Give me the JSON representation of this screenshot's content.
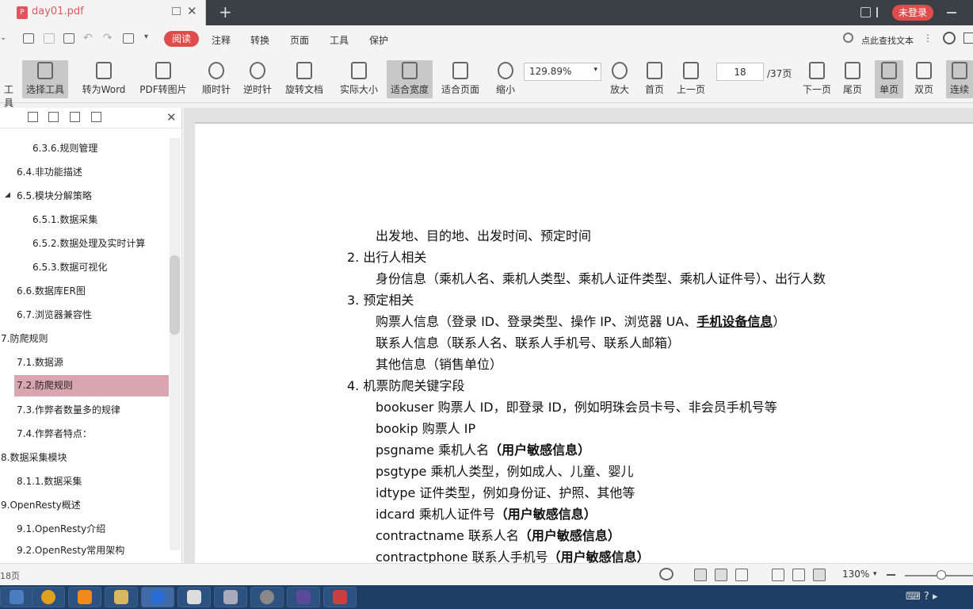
{
  "titlebar": {
    "tab_title": "day01.pdf",
    "new_tab": "+",
    "login_label": "未登录"
  },
  "menu": {
    "items": [
      "阅读",
      "注释",
      "转换",
      "页面",
      "工具",
      "保护"
    ],
    "search_label": "点此查找文本"
  },
  "toolbar": {
    "tools": [
      "工具",
      "选择工具",
      "转为Word",
      "PDF转图片",
      "顺时针",
      "逆时针",
      "旋转文档",
      "实际大小",
      "适合宽度",
      "适合页面",
      "缩小",
      "放大",
      "首页",
      "上一页",
      "下一页",
      "尾页",
      "单页",
      "双页",
      "连续"
    ],
    "zoom_value": "129.89%",
    "page_current": "18",
    "page_total": "/37页"
  },
  "sidebar": {
    "toc": [
      {
        "label": "6.3.6.规则管理",
        "level": 3
      },
      {
        "label": "6.4.非功能描述",
        "level": 2
      },
      {
        "label": "6.5.模块分解策略",
        "level": 2
      },
      {
        "label": "6.5.1.数据采集",
        "level": 3
      },
      {
        "label": "6.5.2.数据处理及实时计算",
        "level": 3
      },
      {
        "label": "6.5.3.数据可视化",
        "level": 3
      },
      {
        "label": "6.6.数据库ER图",
        "level": 2
      },
      {
        "label": "6.7.浏览器兼容性",
        "level": 2
      },
      {
        "label": "7.防爬规则",
        "level": 1
      },
      {
        "label": "7.1.数据源",
        "level": 2
      },
      {
        "label": "7.2.防爬规则",
        "level": 2,
        "selected": true
      },
      {
        "label": "7.3.作弊者数量多的规律",
        "level": 2
      },
      {
        "label": "7.4.作弊者特点：",
        "level": 2
      },
      {
        "label": "8.数据采集模块",
        "level": 1
      },
      {
        "label": "8.1.1.数据采集",
        "level": 2
      },
      {
        "label": "9.OpenResty概述",
        "level": 1
      },
      {
        "label": "9.1.OpenResty介绍",
        "level": 2
      },
      {
        "label": "9.2.OpenResty常用架构",
        "level": 2
      }
    ]
  },
  "document": {
    "lines": [
      {
        "text": "出发地、目的地、出发时间、预定时间"
      },
      {
        "num": "2.",
        "text": "出行人相关"
      },
      {
        "text": "身份信息（乘机人名、乘机人类型、乘机人证件类型、乘机人证件号）、出行人数"
      },
      {
        "num": "3.",
        "text": "预定相关"
      },
      {
        "text": "购票人信息（登录 ID、登录类型、操作 IP、浏览器 UA、",
        "underline": "手机设备信息",
        "tail": "）"
      },
      {
        "text": "联系人信息（联系人名、联系人手机号、联系人邮箱）"
      },
      {
        "text": "其他信息（销售单位）"
      },
      {
        "num": "4.",
        "text": "机票防爬关键字段"
      },
      {
        "text": "bookuser  购票人 ID，即登录 ID，例如明珠会员卡号、非会员手机号等"
      },
      {
        "text": "bookip  购票人 IP"
      },
      {
        "text": "psgname  乘机人名",
        "bold": "（用户敏感信息）"
      },
      {
        "text": "psgtype  乘机人类型，例如成人、儿童、婴儿"
      },
      {
        "text": "idtype  证件类型，例如身份证、护照、其他等"
      },
      {
        "text": "idcard  乘机人证件号",
        "bold": "（用户敏感信息）"
      },
      {
        "text": "contractname  联系人名",
        "bold": "（用户敏感信息）"
      },
      {
        "text": "contractphone  联系人手机号",
        "bold": "（用户敏感信息）"
      }
    ]
  },
  "statusbar": {
    "pages_label": "18页",
    "zoom_label": "130%"
  },
  "colors": {
    "accent": "#e04b4b",
    "selected_toc": "#d9a5b0",
    "taskbar": "#1f3e66"
  }
}
